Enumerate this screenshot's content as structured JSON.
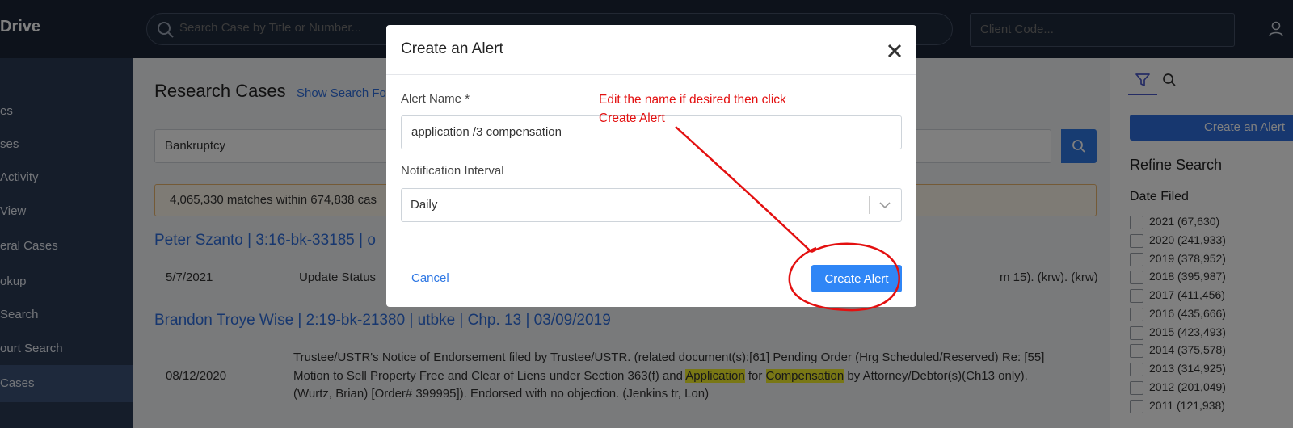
{
  "topbar": {
    "brand": "Drive",
    "search_placeholder": "Search Case by Title or Number...",
    "client_code_placeholder": "Client Code..."
  },
  "sidebar": {
    "items": [
      {
        "label": "es"
      },
      {
        "label": "ses"
      },
      {
        "label": "Activity"
      },
      {
        "label": "View"
      },
      {
        "label": "eral Cases"
      },
      {
        "label": "okup"
      },
      {
        "label": "Search"
      },
      {
        "label": "ourt Search"
      },
      {
        "label": "Cases"
      }
    ]
  },
  "main": {
    "title": "Research Cases",
    "show_filters": "Show Search Fo",
    "query": "Bankruptcy",
    "matches": "4,065,330 matches within 674,838 cas",
    "cases": [
      {
        "title": "Peter Szanto | 3:16-bk-33185 | o",
        "date": "5/7/2021",
        "text": "Update Status",
        "text_tail": "m 15). (krw). (krw)"
      },
      {
        "title": "Brandon Troye Wise | 2:19-bk-21380 | utbke | Chp. 13 | 03/09/2019",
        "date": "08/12/2020",
        "line1": "Trustee/USTR's Notice of Endorsement filed by Trustee/USTR. (related document(s):[61] Pending Order (Hrg Scheduled/Reserved) Re: [55]",
        "line2_a": "Motion to Sell Property Free and Clear of Liens under Section 363(f) and ",
        "line2_hl1": "Application",
        "line2_b": " for ",
        "line2_hl2": "Compensation",
        "line2_c": " by Attorney/Debtor(s)(Ch13 only).",
        "line3": "(Wurtz, Brian) [Order# 399995]). Endorsed with no objection. (Jenkins tr, Lon)"
      }
    ]
  },
  "right_panel": {
    "create_alert": "Create an Alert",
    "refine": "Refine Search",
    "date_filed": "Date Filed",
    "years": [
      {
        "label": "2021 (67,630)"
      },
      {
        "label": "2020 (241,933)"
      },
      {
        "label": "2019 (378,952)"
      },
      {
        "label": "2018 (395,987)"
      },
      {
        "label": "2017 (411,456)"
      },
      {
        "label": "2016 (435,666)"
      },
      {
        "label": "2015 (423,493)"
      },
      {
        "label": "2014 (375,578)"
      },
      {
        "label": "2013 (314,925)"
      },
      {
        "label": "2012 (201,049)"
      },
      {
        "label": "2011 (121,938)"
      }
    ]
  },
  "modal": {
    "title": "Create an Alert",
    "alert_name_label": "Alert Name *",
    "alert_name_value": "application /3 compensation",
    "interval_label": "Notification Interval",
    "interval_value": "Daily",
    "cancel": "Cancel",
    "create": "Create Alert"
  },
  "annotation": {
    "line1": "Edit the name if desired then click",
    "line2": "Create Alert",
    "color": "#e31010"
  }
}
